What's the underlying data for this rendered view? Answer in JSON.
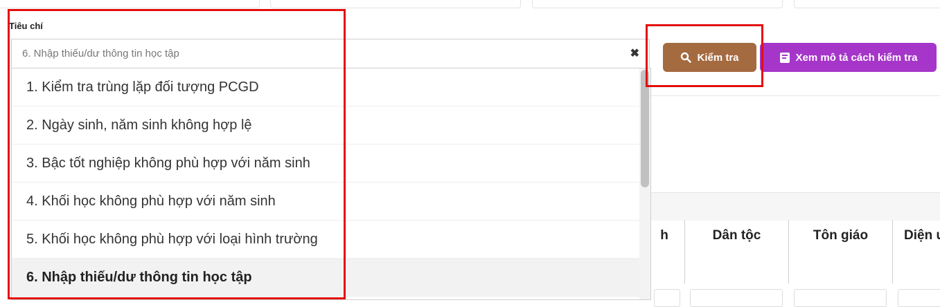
{
  "criteria": {
    "label": "Tiêu chí",
    "selected_value": "6. Nhập thiếu/dư thông tin học tập",
    "clear_symbol": "✖",
    "options": [
      "1. Kiểm tra trùng lặp đối tượng PCGD",
      "2. Ngày sinh, năm sinh không hợp lệ",
      "3. Bậc tốt nghiệp không phù hợp với năm sinh",
      "4. Khối học không phù hợp với năm sinh",
      "5. Khối học không phù hợp với loại hình trường",
      "6. Nhập thiếu/dư thông tin học tập"
    ]
  },
  "buttons": {
    "check_label": "Kiểm tra",
    "description_label": "Xem mô tả cách kiểm tra"
  },
  "table": {
    "headers": [
      "h",
      "Dân tộc",
      "Tôn giáo",
      "Diện u"
    ]
  },
  "colors": {
    "check_button": "#a46a40",
    "description_button": "#a536c9",
    "highlight_box": "#e20d0d"
  }
}
